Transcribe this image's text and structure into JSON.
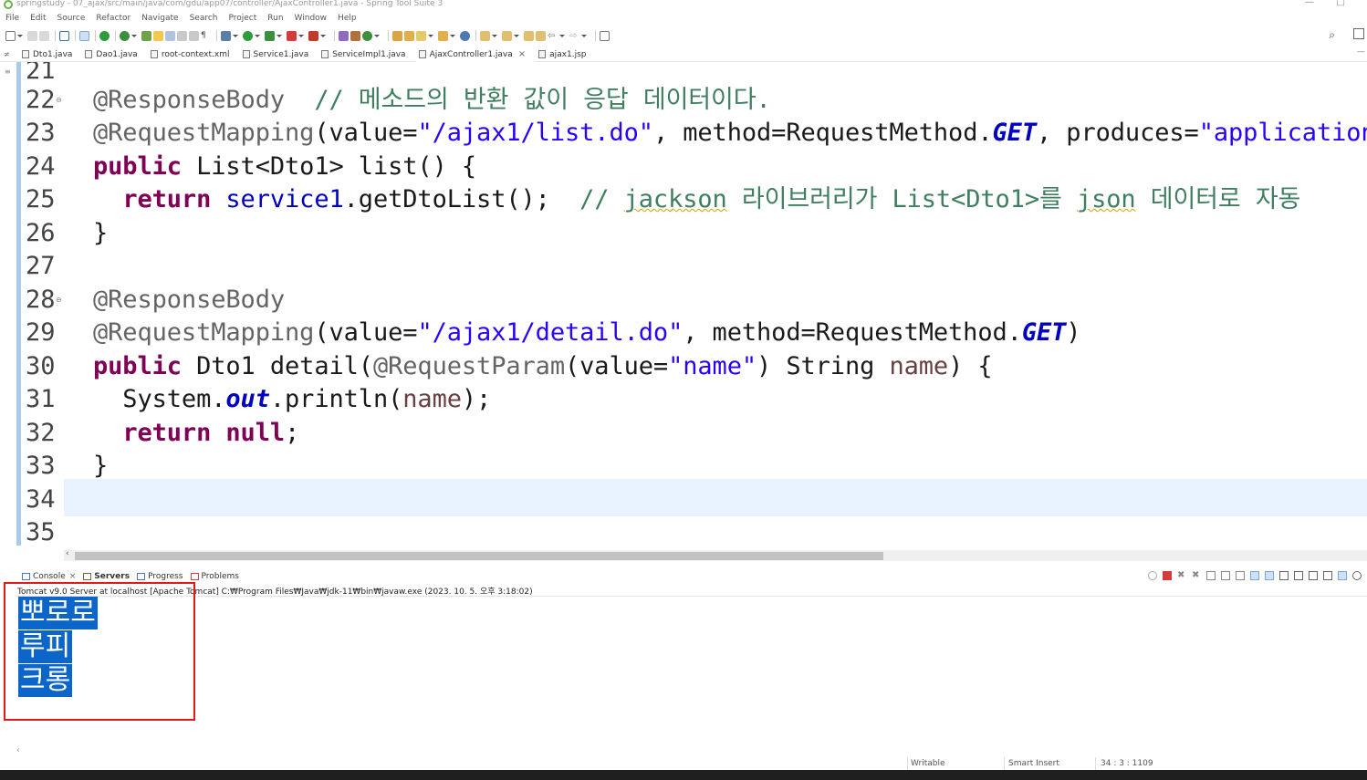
{
  "window": {
    "title": "springstudy - 07_ajax/src/main/java/com/gdu/app07/controller/AjaxController1.java - Spring Tool Suite 3",
    "minimize": "—",
    "maximize": "□"
  },
  "menu": [
    "File",
    "Edit",
    "Source",
    "Refactor",
    "Navigate",
    "Search",
    "Project",
    "Run",
    "Window",
    "Help"
  ],
  "editor_tabs": [
    {
      "label": "Dto1.java"
    },
    {
      "label": "Dao1.java"
    },
    {
      "label": "root-context.xml"
    },
    {
      "label": "Service1.java"
    },
    {
      "label": "ServiceImpl1.java"
    },
    {
      "label": "AjaxController1.java",
      "close": "×"
    },
    {
      "label": "ajax1.jsp"
    }
  ],
  "editor": {
    "lines": [
      {
        "n": "21",
        "fold": false,
        "parts": []
      },
      {
        "n": "22",
        "fold": true,
        "parts": [
          {
            "c": "ann",
            "t": "@ResponseBody"
          },
          {
            "c": "",
            "t": "  "
          },
          {
            "c": "com",
            "t": "// 메소드의 반환 값이 응답 데이터이다."
          }
        ]
      },
      {
        "n": "23",
        "fold": false,
        "parts": [
          {
            "c": "ann",
            "t": "@RequestMapping"
          },
          {
            "c": "",
            "t": "(value="
          },
          {
            "c": "str",
            "t": "\"/ajax1/list.do\""
          },
          {
            "c": "",
            "t": ", method=RequestMethod."
          },
          {
            "c": "sfld",
            "t": "GET"
          },
          {
            "c": "",
            "t": ", produces="
          },
          {
            "c": "str",
            "t": "\"application/"
          }
        ]
      },
      {
        "n": "24",
        "fold": false,
        "parts": [
          {
            "c": "kw",
            "t": "public"
          },
          {
            "c": "",
            "t": " List<Dto1> list() {"
          }
        ]
      },
      {
        "n": "25",
        "fold": false,
        "parts": [
          {
            "c": "",
            "t": "  "
          },
          {
            "c": "kw",
            "t": "return"
          },
          {
            "c": "",
            "t": " "
          },
          {
            "c": "fld",
            "t": "service1"
          },
          {
            "c": "",
            "t": ".getDtoList();  "
          },
          {
            "c": "com",
            "t": "// "
          },
          {
            "c": "com und",
            "t": "jackson"
          },
          {
            "c": "com",
            "t": " 라이브러리가 List<Dto1>를 "
          },
          {
            "c": "com und",
            "t": "json"
          },
          {
            "c": "com",
            "t": " 데이터로 자동"
          }
        ]
      },
      {
        "n": "26",
        "fold": false,
        "parts": [
          {
            "c": "",
            "t": "}"
          }
        ]
      },
      {
        "n": "27",
        "fold": false,
        "parts": []
      },
      {
        "n": "28",
        "fold": true,
        "parts": [
          {
            "c": "ann",
            "t": "@ResponseBody"
          }
        ]
      },
      {
        "n": "29",
        "fold": false,
        "parts": [
          {
            "c": "ann",
            "t": "@RequestMapping"
          },
          {
            "c": "",
            "t": "(value="
          },
          {
            "c": "str",
            "t": "\"/ajax1/detail.do\""
          },
          {
            "c": "",
            "t": ", method=RequestMethod."
          },
          {
            "c": "sfld",
            "t": "GET"
          },
          {
            "c": "",
            "t": ")"
          }
        ]
      },
      {
        "n": "30",
        "fold": false,
        "parts": [
          {
            "c": "kw",
            "t": "public"
          },
          {
            "c": "",
            "t": " Dto1 detail("
          },
          {
            "c": "ann",
            "t": "@RequestParam"
          },
          {
            "c": "",
            "t": "(value="
          },
          {
            "c": "str",
            "t": "\"name\""
          },
          {
            "c": "",
            "t": ") String "
          },
          {
            "c": "var",
            "t": "name"
          },
          {
            "c": "",
            "t": ") {"
          }
        ]
      },
      {
        "n": "31",
        "fold": false,
        "parts": [
          {
            "c": "",
            "t": "  System."
          },
          {
            "c": "sfld",
            "t": "out"
          },
          {
            "c": "",
            "t": ".println("
          },
          {
            "c": "var",
            "t": "name"
          },
          {
            "c": "",
            "t": ");"
          }
        ]
      },
      {
        "n": "32",
        "fold": false,
        "parts": [
          {
            "c": "",
            "t": "  "
          },
          {
            "c": "kw",
            "t": "return"
          },
          {
            "c": "",
            "t": " "
          },
          {
            "c": "kw",
            "t": "null"
          },
          {
            "c": "",
            "t": ";"
          }
        ]
      },
      {
        "n": "33",
        "fold": false,
        "parts": [
          {
            "c": "",
            "t": "}"
          }
        ]
      },
      {
        "n": "34",
        "fold": false,
        "parts": []
      },
      {
        "n": "35",
        "fold": false,
        "parts": []
      }
    ]
  },
  "views": {
    "tabs": [
      {
        "label": "Console",
        "close": "×",
        "bold": false
      },
      {
        "label": "Servers",
        "bold": true
      },
      {
        "label": "Progress",
        "bold": false
      },
      {
        "label": "Problems",
        "bold": false
      }
    ],
    "console_description": "Tomcat v9.0 Server at localhost [Apache Tomcat] C:₩Program Files₩Java₩jdk-11₩bin₩javaw.exe  (2023. 10. 5. 오후 3:18:02)",
    "console_lines": [
      "뽀로로",
      "루피",
      "크롱"
    ]
  },
  "status": {
    "writable": "Writable",
    "insert_mode": "Smart Insert",
    "position": "34 : 3 : 1109"
  },
  "colors": {
    "highlight_box": "#e01919",
    "selection": "#0c65c8",
    "current_line": "#e8f2fe"
  }
}
